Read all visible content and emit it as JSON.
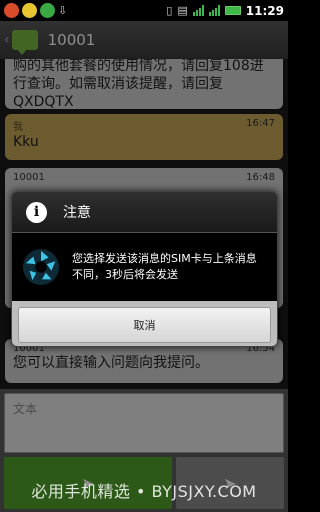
{
  "status_bar": {
    "time": "11:29"
  },
  "titlebar": {
    "title": "10001"
  },
  "messages": [
    {
      "text": "购的其他套餐的使用情况，请回复108进行查询。如需取消该提醒，请回复QXDQTX",
      "sender": "",
      "time": ""
    },
    {
      "text": "Kku",
      "sender": "我",
      "time": "16:47"
    },
    {
      "text": "",
      "sender": "10001",
      "time": "16:48"
    },
    {
      "text": "您可以直接输入问题向我提问。",
      "sender": "10001",
      "time": "16:54"
    }
  ],
  "compose": {
    "placeholder": "文本"
  },
  "dialog": {
    "title": "注意",
    "message": "您选择发送该消息的SIM卡与上条消息不同，3秒后将会发送",
    "cancel_label": "取消"
  },
  "watermark": "必用手机精选 • BYJSJXY.COM",
  "colors": {
    "accent_green": "#52a32c",
    "bubble_out": "#c9a85a",
    "bubble_in": "#cfcfcf"
  }
}
